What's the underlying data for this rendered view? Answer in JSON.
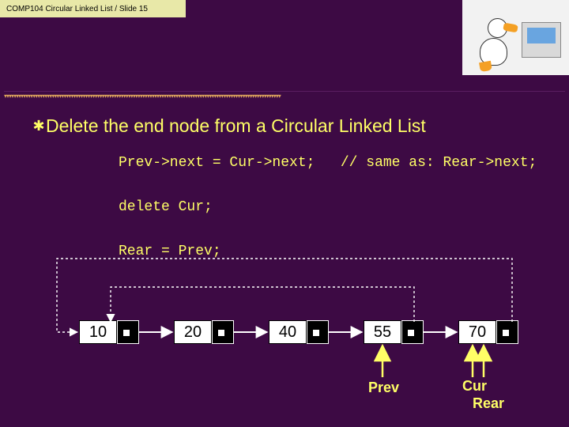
{
  "header": "COMP104 Circular Linked List / Slide 15",
  "title_word": "Delete",
  "title_rest": " the end node from a Circular Linked List",
  "code": {
    "l1a": "Prev->next = Cur->next;",
    "l1b": "// same as: Rear->next;",
    "l2": "delete Cur;",
    "l3": "Rear = Prev;"
  },
  "nodes": {
    "n1": "10",
    "n2": "20",
    "n3": "40",
    "n4": "55",
    "n5": "70"
  },
  "labels": {
    "prev": "Prev",
    "cur": "Cur",
    "rear": "Rear"
  }
}
